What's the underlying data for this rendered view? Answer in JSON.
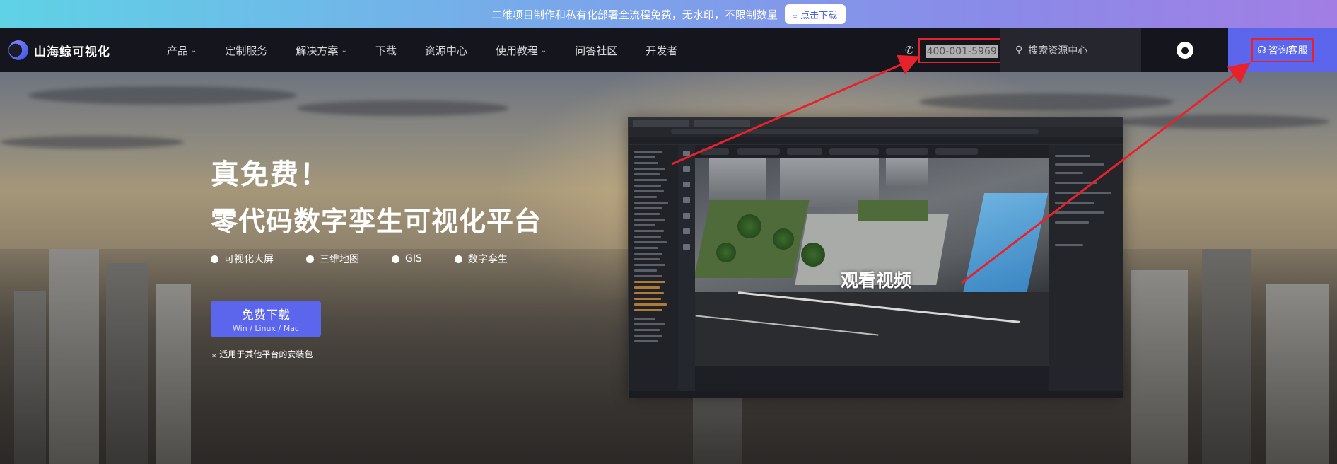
{
  "promo": {
    "text": "二维项目制作和私有化部署全流程免费，无水印，不限制数量",
    "button_label": "点击下载"
  },
  "nav": {
    "logo_text": "山海鲸可视化",
    "menu": [
      {
        "label": "产品",
        "has_dropdown": true
      },
      {
        "label": "定制服务",
        "has_dropdown": false
      },
      {
        "label": "解决方案",
        "has_dropdown": true
      },
      {
        "label": "下载",
        "has_dropdown": false
      },
      {
        "label": "资源中心",
        "has_dropdown": false
      },
      {
        "label": "使用教程",
        "has_dropdown": true
      },
      {
        "label": "问答社区",
        "has_dropdown": false
      },
      {
        "label": "开发者",
        "has_dropdown": false
      }
    ],
    "phone": "400-001-5969",
    "search_placeholder": "搜索资源中心",
    "consult_label": "咨询客服"
  },
  "hero": {
    "title1": "真免费！",
    "title2": "零代码数字孪生可视化平台",
    "features": [
      "可视化大屏",
      "三维地图",
      "GIS",
      "数字孪生"
    ],
    "download": {
      "label": "免费下载",
      "platforms": "Win / Linux / Mac"
    },
    "other_packages": "适用于其他平台的安装包",
    "video_label": "观看视频"
  },
  "colors": {
    "accent": "#5b66ec",
    "nav_bg": "#15161d",
    "highlight": "#e8222a"
  }
}
